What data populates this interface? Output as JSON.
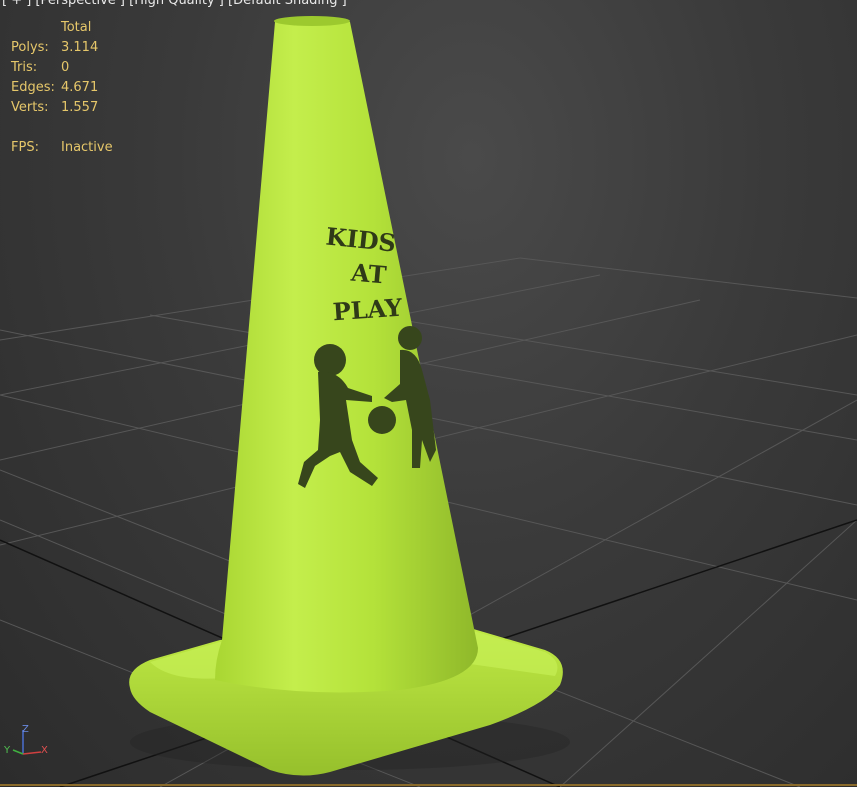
{
  "viewport": {
    "label": "[ + ] [Perspective ] [High Quality ] [Default Shading ]"
  },
  "stats": {
    "header": "Total",
    "polys_label": "Polys:",
    "polys_value": "3.114",
    "tris_label": "Tris:",
    "tris_value": "0",
    "edges_label": "Edges:",
    "edges_value": "4.671",
    "verts_label": "Verts:",
    "verts_value": "1.557",
    "fps_label": "FPS:",
    "fps_value": "Inactive"
  },
  "cone_decal": {
    "line1": "KIDS",
    "line2": "AT",
    "line3": "PLAY"
  },
  "axis_gizmo": {
    "x": "X",
    "y": "Y",
    "z": "Z"
  },
  "colors": {
    "stats_text": "#e6c76a",
    "cone_green": "#b5e33a",
    "grid_line": "#555555",
    "background": "#3a3a3a"
  }
}
